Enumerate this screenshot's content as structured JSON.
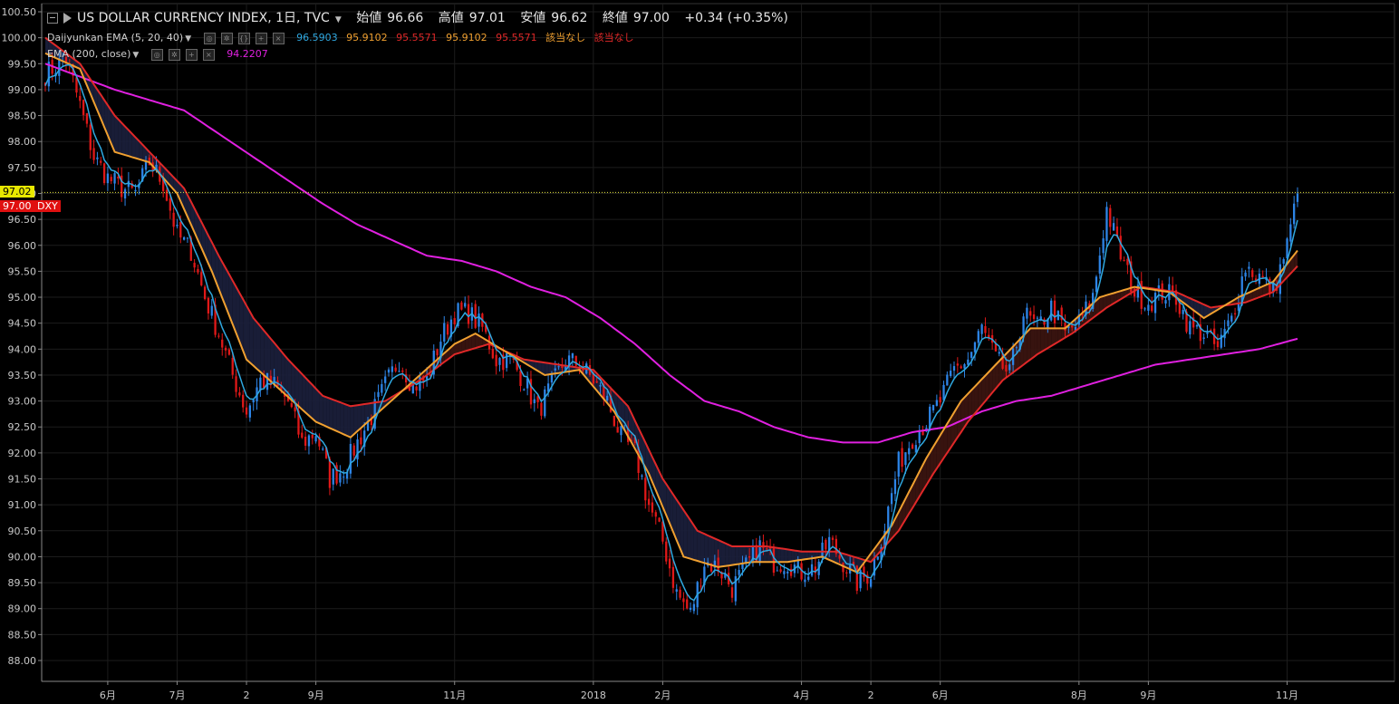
{
  "header": {
    "title": "US DOLLAR CURRENCY INDEX, 1日, TVC",
    "ohlc": [
      {
        "label": "始値",
        "value": "96.66"
      },
      {
        "label": "高値",
        "value": "97.01"
      },
      {
        "label": "安値",
        "value": "96.62"
      },
      {
        "label": "終値",
        "value": "97.00"
      }
    ],
    "change": "+0.34 (+0.35%)"
  },
  "indicators": [
    {
      "name": "Daijyunkan EMA (5, 20, 40)",
      "values": [
        {
          "text": "96.5903",
          "color": "#2fa8e0"
        },
        {
          "text": "95.9102",
          "color": "#f0a030"
        },
        {
          "text": "95.5571",
          "color": "#e02828"
        },
        {
          "text": "95.9102",
          "color": "#f0a030"
        },
        {
          "text": "95.5571",
          "color": "#e02828"
        },
        {
          "text": "該当なし",
          "color": "#f0a030"
        },
        {
          "text": "該当なし",
          "color": "#e02828"
        }
      ]
    },
    {
      "name": "EMA (200, close)",
      "values": [
        {
          "text": "94.2207",
          "color": "#e020e0"
        }
      ]
    }
  ],
  "price_labels": {
    "crosshair": "97.02",
    "last": "97.00",
    "symbol": "DXY"
  },
  "colors": {
    "background": "#000000",
    "up": "#2d84e6",
    "down": "#e01818",
    "ema5": "#2fa8e0",
    "ema20": "#f0a030",
    "ema40": "#e02828",
    "ema200": "#e020e0",
    "fill_bear": "#1a1f3a",
    "fill_bull": "#3a1410",
    "crosshair": "#e8e840"
  },
  "chart_data": {
    "type": "candlestick",
    "title": "US DOLLAR CURRENCY INDEX, 1日, TVC",
    "ylim": [
      87.8,
      100.5
    ],
    "yticks": [
      "100.50",
      "100.00",
      "99.50",
      "99.00",
      "98.50",
      "98.00",
      "97.50",
      "97.00",
      "96.50",
      "96.00",
      "95.50",
      "95.00",
      "94.50",
      "94.00",
      "93.50",
      "93.00",
      "92.50",
      "92.00",
      "91.50",
      "91.00",
      "90.50",
      "90.00",
      "89.50",
      "89.00",
      "88.50",
      "88.00"
    ],
    "xticks": [
      "6月",
      "7月",
      "2",
      "9月",
      "11月",
      "2018",
      "2月",
      "4月",
      "2",
      "6月",
      "8月",
      "9月",
      "11月"
    ],
    "xtick_index": [
      18,
      38,
      58,
      78,
      118,
      158,
      178,
      218,
      238,
      258,
      298,
      318,
      358
    ],
    "n_bars": 362,
    "crosshair_price": 97.02,
    "close_anchors": [
      [
        0,
        99.3
      ],
      [
        6,
        99.6
      ],
      [
        10,
        98.7
      ],
      [
        14,
        97.7
      ],
      [
        18,
        97.3
      ],
      [
        22,
        97.1
      ],
      [
        26,
        97.0
      ],
      [
        30,
        97.6
      ],
      [
        34,
        97.2
      ],
      [
        38,
        96.2
      ],
      [
        42,
        95.9
      ],
      [
        46,
        95.0
      ],
      [
        50,
        94.3
      ],
      [
        54,
        93.5
      ],
      [
        58,
        92.8
      ],
      [
        62,
        93.4
      ],
      [
        66,
        93.3
      ],
      [
        70,
        93.0
      ],
      [
        74,
        92.2
      ],
      [
        78,
        92.4
      ],
      [
        82,
        91.5
      ],
      [
        86,
        91.7
      ],
      [
        90,
        92.2
      ],
      [
        94,
        92.7
      ],
      [
        98,
        93.3
      ],
      [
        102,
        93.8
      ],
      [
        106,
        93.3
      ],
      [
        110,
        93.4
      ],
      [
        114,
        94.2
      ],
      [
        118,
        94.7
      ],
      [
        122,
        94.7
      ],
      [
        126,
        94.4
      ],
      [
        130,
        93.8
      ],
      [
        134,
        93.8
      ],
      [
        138,
        93.4
      ],
      [
        142,
        92.8
      ],
      [
        146,
        93.3
      ],
      [
        150,
        93.8
      ],
      [
        154,
        93.7
      ],
      [
        158,
        93.4
      ],
      [
        162,
        93.0
      ],
      [
        166,
        92.3
      ],
      [
        170,
        92.0
      ],
      [
        174,
        91.0
      ],
      [
        178,
        90.3
      ],
      [
        182,
        89.3
      ],
      [
        186,
        88.9
      ],
      [
        190,
        89.9
      ],
      [
        194,
        89.8
      ],
      [
        198,
        89.4
      ],
      [
        202,
        89.8
      ],
      [
        206,
        90.2
      ],
      [
        210,
        89.9
      ],
      [
        214,
        89.9
      ],
      [
        218,
        89.7
      ],
      [
        222,
        89.8
      ],
      [
        226,
        90.3
      ],
      [
        230,
        89.9
      ],
      [
        234,
        89.5
      ],
      [
        238,
        89.7
      ],
      [
        242,
        90.6
      ],
      [
        246,
        91.8
      ],
      [
        250,
        92.3
      ],
      [
        254,
        92.6
      ],
      [
        258,
        93.0
      ],
      [
        262,
        93.6
      ],
      [
        266,
        93.8
      ],
      [
        270,
        94.4
      ],
      [
        274,
        93.8
      ],
      [
        278,
        93.5
      ],
      [
        282,
        94.7
      ],
      [
        286,
        94.4
      ],
      [
        290,
        94.8
      ],
      [
        294,
        94.3
      ],
      [
        298,
        94.5
      ],
      [
        302,
        95.0
      ],
      [
        306,
        96.7
      ],
      [
        310,
        95.8
      ],
      [
        314,
        95.1
      ],
      [
        318,
        94.9
      ],
      [
        322,
        95.1
      ],
      [
        326,
        95.0
      ],
      [
        330,
        94.4
      ],
      [
        334,
        94.3
      ],
      [
        338,
        94.0
      ],
      [
        342,
        94.6
      ],
      [
        346,
        95.6
      ],
      [
        350,
        95.4
      ],
      [
        354,
        95.1
      ],
      [
        358,
        96.0
      ],
      [
        361,
        97.0
      ]
    ],
    "ema_anchors": {
      "ema20": [
        [
          0,
          99.7
        ],
        [
          10,
          99.4
        ],
        [
          20,
          97.8
        ],
        [
          30,
          97.6
        ],
        [
          38,
          97.0
        ],
        [
          48,
          95.5
        ],
        [
          58,
          93.8
        ],
        [
          68,
          93.2
        ],
        [
          78,
          92.6
        ],
        [
          88,
          92.3
        ],
        [
          98,
          92.9
        ],
        [
          108,
          93.5
        ],
        [
          118,
          94.1
        ],
        [
          124,
          94.3
        ],
        [
          134,
          93.9
        ],
        [
          144,
          93.5
        ],
        [
          154,
          93.6
        ],
        [
          164,
          92.8
        ],
        [
          174,
          91.6
        ],
        [
          184,
          90.0
        ],
        [
          194,
          89.8
        ],
        [
          204,
          89.9
        ],
        [
          214,
          89.9
        ],
        [
          224,
          90.0
        ],
        [
          234,
          89.7
        ],
        [
          244,
          90.6
        ],
        [
          254,
          91.9
        ],
        [
          264,
          93.0
        ],
        [
          274,
          93.7
        ],
        [
          284,
          94.4
        ],
        [
          294,
          94.4
        ],
        [
          304,
          95.0
        ],
        [
          314,
          95.2
        ],
        [
          324,
          95.1
        ],
        [
          334,
          94.6
        ],
        [
          344,
          95.0
        ],
        [
          354,
          95.3
        ],
        [
          361,
          95.9
        ]
      ],
      "ema40": [
        [
          0,
          100.0
        ],
        [
          10,
          99.5
        ],
        [
          20,
          98.5
        ],
        [
          30,
          97.8
        ],
        [
          40,
          97.1
        ],
        [
          50,
          95.8
        ],
        [
          60,
          94.6
        ],
        [
          70,
          93.8
        ],
        [
          80,
          93.1
        ],
        [
          88,
          92.9
        ],
        [
          98,
          93.0
        ],
        [
          108,
          93.4
        ],
        [
          118,
          93.9
        ],
        [
          128,
          94.1
        ],
        [
          138,
          93.8
        ],
        [
          148,
          93.7
        ],
        [
          158,
          93.6
        ],
        [
          168,
          92.9
        ],
        [
          178,
          91.5
        ],
        [
          188,
          90.5
        ],
        [
          198,
          90.2
        ],
        [
          208,
          90.2
        ],
        [
          218,
          90.1
        ],
        [
          228,
          90.1
        ],
        [
          238,
          89.9
        ],
        [
          246,
          90.5
        ],
        [
          256,
          91.6
        ],
        [
          266,
          92.6
        ],
        [
          276,
          93.4
        ],
        [
          286,
          93.9
        ],
        [
          296,
          94.3
        ],
        [
          306,
          94.8
        ],
        [
          316,
          95.2
        ],
        [
          326,
          95.1
        ],
        [
          336,
          94.8
        ],
        [
          346,
          94.9
        ],
        [
          354,
          95.1
        ],
        [
          361,
          95.6
        ]
      ],
      "ema200": [
        [
          0,
          99.5
        ],
        [
          20,
          99.0
        ],
        [
          40,
          98.6
        ],
        [
          60,
          97.7
        ],
        [
          80,
          96.8
        ],
        [
          90,
          96.4
        ],
        [
          100,
          96.1
        ],
        [
          110,
          95.8
        ],
        [
          120,
          95.7
        ],
        [
          130,
          95.5
        ],
        [
          140,
          95.2
        ],
        [
          150,
          95.0
        ],
        [
          160,
          94.6
        ],
        [
          170,
          94.1
        ],
        [
          180,
          93.5
        ],
        [
          190,
          93.0
        ],
        [
          200,
          92.8
        ],
        [
          210,
          92.5
        ],
        [
          220,
          92.3
        ],
        [
          230,
          92.2
        ],
        [
          240,
          92.2
        ],
        [
          250,
          92.4
        ],
        [
          260,
          92.5
        ],
        [
          270,
          92.8
        ],
        [
          280,
          93.0
        ],
        [
          290,
          93.1
        ],
        [
          300,
          93.3
        ],
        [
          310,
          93.5
        ],
        [
          320,
          93.7
        ],
        [
          330,
          93.8
        ],
        [
          340,
          93.9
        ],
        [
          350,
          94.0
        ],
        [
          361,
          94.2
        ]
      ]
    }
  }
}
